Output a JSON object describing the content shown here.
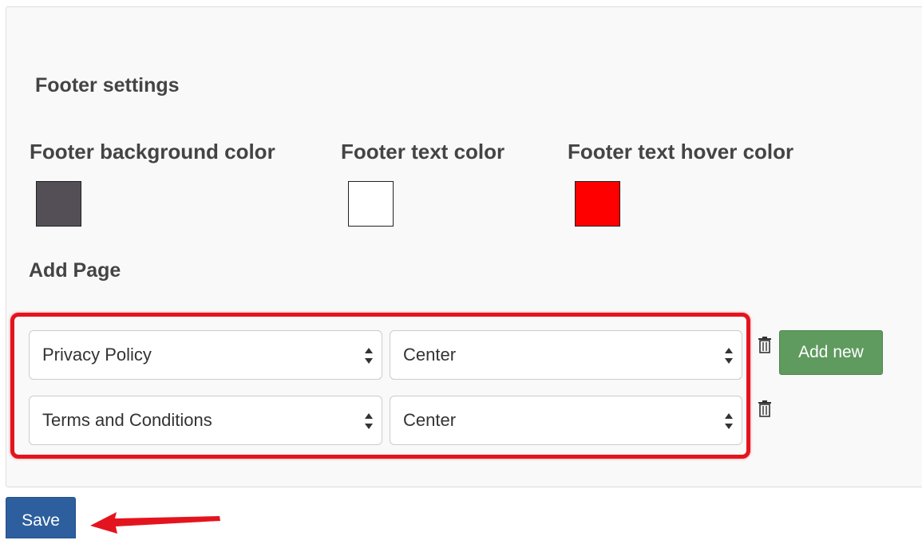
{
  "footer": {
    "title": "Footer settings",
    "colors": [
      {
        "label": "Footer background color",
        "value": "#544f57"
      },
      {
        "label": "Footer text color",
        "value": "#ffffff"
      },
      {
        "label": "Footer text hover color",
        "value": "#ff0000"
      }
    ]
  },
  "add_page": {
    "title": "Add Page",
    "rows": [
      {
        "page": "Privacy Policy",
        "alignment": "Center"
      },
      {
        "page": "Terms and Conditions",
        "alignment": "Center"
      }
    ],
    "delete_icon": "trash-icon",
    "add_new_label": "Add new"
  },
  "actions": {
    "save_label": "Save"
  },
  "annotation": {
    "highlight_color": "#e4141e",
    "arrow_color": "#e4141e"
  }
}
